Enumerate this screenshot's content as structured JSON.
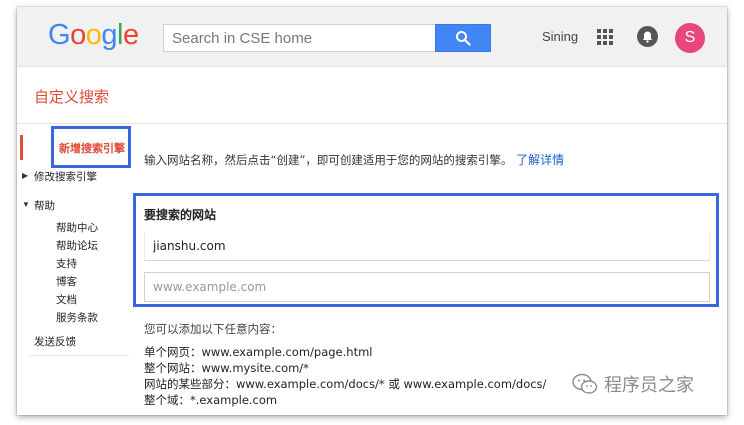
{
  "header": {
    "logo_text": "Google",
    "search_placeholder": "Search in CSE home",
    "user_name": "Sining",
    "avatar_letter": "S",
    "search_icon": "search-icon",
    "apps_icon": "apps-grid-icon",
    "notifications_icon": "bell-icon"
  },
  "product_title": "自定义搜索",
  "sidebar": {
    "new_engine": "新增搜索引擎",
    "edit_engine": "修改搜索引擎",
    "help": "帮助",
    "help_items": [
      "帮助中心",
      "帮助论坛",
      "支持",
      "博客",
      "文档",
      "服务条款"
    ],
    "feedback": "发送反馈"
  },
  "main": {
    "intro_text": "输入网站名称，然后点击“创建”，即可创建适用于您的网站的搜索引擎。",
    "learn_more": "了解详情",
    "sites_label": "要搜索的网站",
    "site_value": "jianshu.com",
    "site_placeholder": "www.example.com",
    "examples_title": "您可以添加以下任意内容：",
    "examples": [
      "单个网页：www.example.com/page.html",
      "整个网站：www.mysite.com/*",
      "网站的某些部分：www.example.com/docs/* 或 www.example.com/docs/",
      "整个域：*.example.com"
    ]
  },
  "watermark": "程序员之家",
  "colors": {
    "brand_red": "#dd4b39",
    "search_blue": "#4285f4",
    "highlight_blue": "#3a66e0",
    "link_blue": "#1a5fc9",
    "avatar_pink": "#e8467e"
  }
}
